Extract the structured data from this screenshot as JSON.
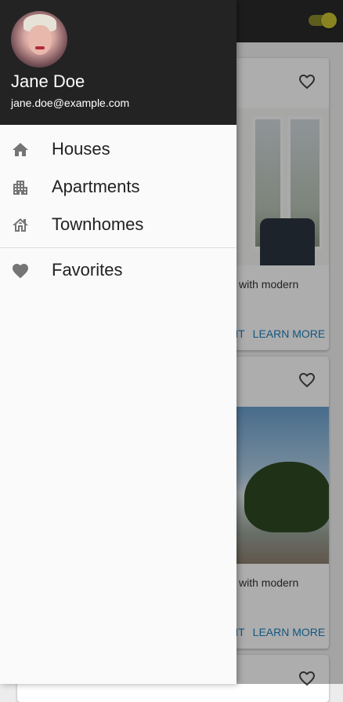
{
  "app": {
    "accent_color": "#c9c432",
    "toggle_state": "on",
    "cards": [
      {
        "text_fragment": "with modern",
        "action_fragment": "NT",
        "action_label": "LEARN MORE",
        "favorite_icon": "heart-outline-icon"
      },
      {
        "text_fragment": "with modern",
        "action_fragment": "NT",
        "action_label": "LEARN MORE",
        "favorite_icon": "heart-outline-icon"
      },
      {
        "favorite_icon": "heart-outline-icon"
      }
    ]
  },
  "drawer": {
    "header_color": "#232323",
    "user": {
      "name": "Jane Doe",
      "email": "jane.doe@example.com"
    },
    "items": [
      {
        "label": "Houses",
        "icon": "home-icon"
      },
      {
        "label": "Apartments",
        "icon": "apartment-icon"
      },
      {
        "label": "Townhomes",
        "icon": "townhome-icon"
      },
      {
        "label": "Favorites",
        "icon": "heart-icon"
      }
    ]
  }
}
